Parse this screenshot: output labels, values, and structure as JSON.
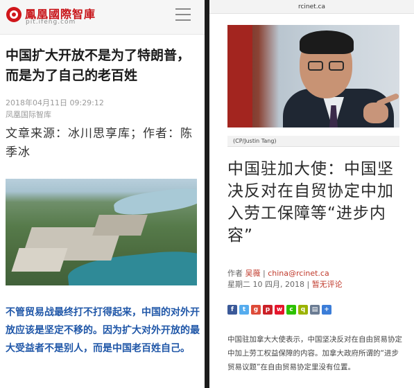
{
  "left": {
    "header": {
      "brand": "鳳凰國際智庫",
      "domain": "pit.ifeng.com",
      "brand_color": "#c81419"
    },
    "article": {
      "title": "中国扩大开放不是为了特朗普，而是为了自己的老百姓",
      "date": "2018年04月11日 09:29:12",
      "source": "凤凰国际智库",
      "author_line": "文章来源：冰川思享库；作者：陈季冰",
      "lead": "不管贸易战最终打不打得起来，中国的对外开放应该是坚定不移的。因为扩大对外开放的最大受益者不是别人，而是中国老百姓自己。",
      "lead_color": "#2057a8"
    }
  },
  "right": {
    "url": "rcinet.ca",
    "photo_credit": "(CP/Justin Tang)",
    "title": "中国驻加大使：中国坚决反对在自贸协定中加入劳工保障等“进步内容”",
    "meta": {
      "author_label": "作者",
      "author_name": "吴薇",
      "author_sep": " | ",
      "email": "china@rcinet.ca",
      "date": "星期二 10 四月, 2018",
      "comments": "暂无评论"
    },
    "share_icons": [
      {
        "name": "facebook-icon",
        "glyph": "f",
        "color": "#3b5998"
      },
      {
        "name": "twitter-icon",
        "glyph": "t",
        "color": "#55acee"
      },
      {
        "name": "google-plus-icon",
        "glyph": "g",
        "color": "#dd4b39"
      },
      {
        "name": "pinterest-icon",
        "glyph": "p",
        "color": "#cb2027"
      },
      {
        "name": "weibo-icon",
        "glyph": "w",
        "color": "#e6162d"
      },
      {
        "name": "wechat-icon",
        "glyph": "c",
        "color": "#2dc100"
      },
      {
        "name": "qzone-icon",
        "glyph": "q",
        "color": "#9bb300"
      },
      {
        "name": "print-icon",
        "glyph": "▤",
        "color": "#6b7c93"
      },
      {
        "name": "more-icon",
        "glyph": "+",
        "color": "#3b7dd8"
      }
    ],
    "body": "中国驻加拿大大使表示，中国坚决反对在自由贸易协定中加上劳工权益保障的内容。加拿大政府所谓的“进步贸易议题”在自由贸易协定里没有位置。"
  }
}
